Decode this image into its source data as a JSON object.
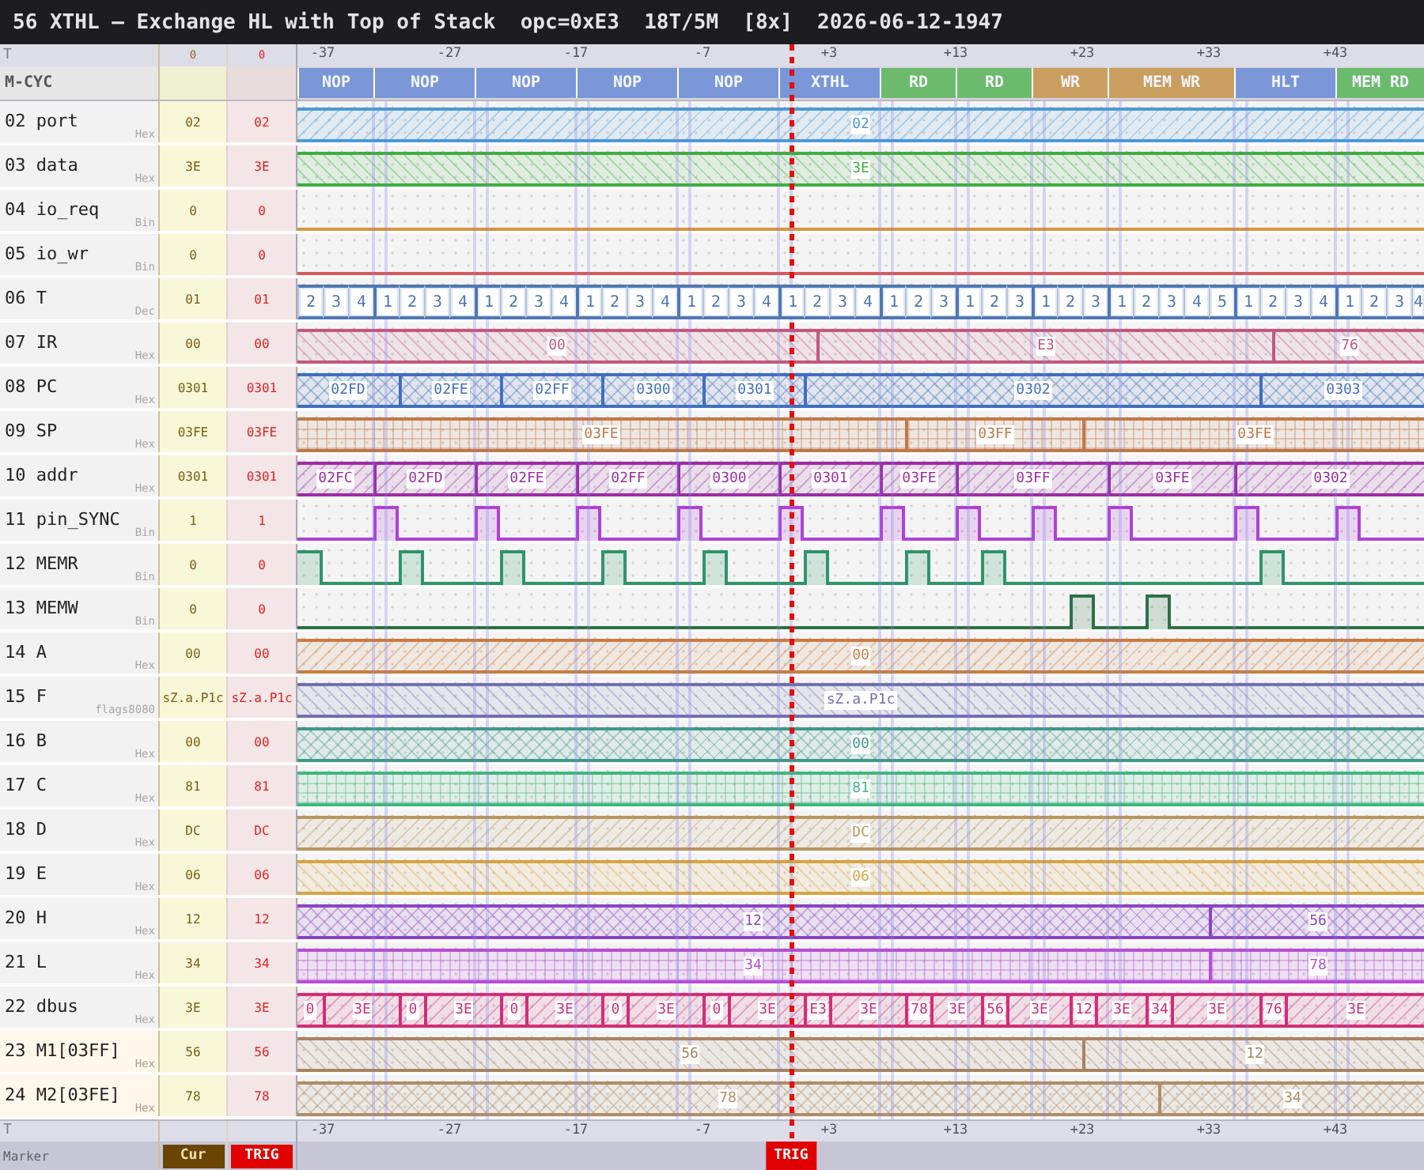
{
  "title": {
    "text": "56 XTHL — Exchange HL with Top of Stack",
    "info": [
      "opc=0xE3",
      "18T/5M",
      "[8x]",
      "2026-06-12-1947"
    ]
  },
  "timeline": {
    "label": "T",
    "cur": "0",
    "trig": "0",
    "ticks": [
      "-37",
      "-27",
      "-17",
      "-7",
      "+3",
      "+13",
      "+23",
      "+33",
      "+43"
    ]
  },
  "m_cycles": {
    "label": "M-CYC",
    "items": [
      {
        "label": "NOP",
        "color": "#7b97d8"
      },
      {
        "label": "NOP",
        "color": "#7b97d8"
      },
      {
        "label": "NOP",
        "color": "#7b97d8"
      },
      {
        "label": "NOP",
        "color": "#7b97d8"
      },
      {
        "label": "NOP",
        "color": "#7b97d8"
      },
      {
        "label": "XTHL",
        "color": "#7b97d8"
      },
      {
        "label": "RD",
        "color": "#6cba6c"
      },
      {
        "label": "RD",
        "color": "#6cba6c"
      },
      {
        "label": "WR",
        "color": "#c99e5e"
      },
      {
        "label": "MEM WR",
        "color": "#c99e5e"
      },
      {
        "label": "HLT",
        "color": "#7b97d8"
      },
      {
        "label": "MEM RD",
        "color": "#6cba6c"
      }
    ]
  },
  "rows": [
    {
      "name": "02 port",
      "format": "Hex",
      "cur": "02",
      "trig": "02",
      "watch": false,
      "kind": "bus",
      "color": "#4a9ad8",
      "segments": [
        {
          "value": "02"
        }
      ]
    },
    {
      "name": "03 data",
      "format": "Hex",
      "cur": "3E",
      "trig": "3E",
      "watch": false,
      "kind": "bus",
      "color": "#3fae3f",
      "segments": [
        {
          "value": "3E"
        }
      ]
    },
    {
      "name": "04 io_req",
      "format": "Bin",
      "cur": "0",
      "trig": "0",
      "watch": false,
      "kind": "bit",
      "color": "#d8963a",
      "segments": [
        {
          "high": false
        }
      ]
    },
    {
      "name": "05 io_wr",
      "format": "Bin",
      "cur": "0",
      "trig": "0",
      "watch": false,
      "kind": "bit",
      "color": "#d85a5a",
      "segments": [
        {
          "high": false
        }
      ]
    },
    {
      "name": "06 T",
      "format": "Dec",
      "cur": "01",
      "trig": "01",
      "watch": false,
      "kind": "tstate",
      "color": "#4f77b3",
      "cells": [
        "2",
        "3",
        "4",
        "1",
        "2",
        "3",
        "4",
        "1",
        "2",
        "3",
        "4",
        "1",
        "2",
        "3",
        "4",
        "1",
        "2",
        "3",
        "4",
        "1",
        "2",
        "3",
        "4",
        "1",
        "2",
        "3",
        "1",
        "2",
        "3",
        "1",
        "2",
        "3",
        "1",
        "2",
        "3",
        "4",
        "5",
        "1",
        "2",
        "3",
        "4",
        "1",
        "2",
        "3",
        "4"
      ]
    },
    {
      "name": "07 IR",
      "format": "Hex",
      "cur": "00",
      "trig": "00",
      "watch": false,
      "kind": "bus",
      "color": "#c2577f",
      "segments": [
        {
          "value": "00"
        },
        {
          "value": "E3"
        },
        {
          "value": "76"
        }
      ]
    },
    {
      "name": "08 PC",
      "format": "Hex",
      "cur": "0301",
      "trig": "0301",
      "watch": false,
      "kind": "bus",
      "color": "#3f6fbf",
      "segments": [
        {
          "value": "02FD"
        },
        {
          "value": "02FE"
        },
        {
          "value": "02FF"
        },
        {
          "value": "0300"
        },
        {
          "value": "0301"
        },
        {
          "value": "0302"
        },
        {
          "value": "0303"
        }
      ]
    },
    {
      "name": "09 SP",
      "format": "Hex",
      "cur": "03FE",
      "trig": "03FE",
      "watch": false,
      "kind": "bus",
      "color": "#c07848",
      "segments": [
        {
          "value": "03FE"
        },
        {
          "value": "03FF"
        },
        {
          "value": "03FE"
        }
      ]
    },
    {
      "name": "10 addr",
      "format": "Hex",
      "cur": "0301",
      "trig": "0301",
      "watch": false,
      "kind": "bus",
      "color": "#9c2ca4",
      "segments": [
        {
          "value": "02FC"
        },
        {
          "value": "02FD"
        },
        {
          "value": "02FE"
        },
        {
          "value": "02FF"
        },
        {
          "value": "0300"
        },
        {
          "value": "0301"
        },
        {
          "value": "03FE"
        },
        {
          "value": "03FF"
        },
        {
          "value": "03FE"
        },
        {
          "value": "0302"
        }
      ]
    },
    {
      "name": "11 pin_SYNC",
      "format": "Bin",
      "cur": "1",
      "trig": "1",
      "watch": false,
      "kind": "bit",
      "color": "#b040d8",
      "segments": [
        {
          "high": false
        },
        {
          "high": true
        },
        {
          "high": false
        },
        {
          "high": true
        },
        {
          "high": false
        },
        {
          "high": true
        },
        {
          "high": false
        },
        {
          "high": true
        },
        {
          "high": false
        },
        {
          "high": true
        },
        {
          "high": false
        },
        {
          "high": true
        },
        {
          "high": false
        },
        {
          "high": true
        },
        {
          "high": false
        },
        {
          "high": true
        },
        {
          "high": false
        },
        {
          "high": true
        },
        {
          "high": false
        },
        {
          "high": true
        },
        {
          "high": false
        },
        {
          "high": true
        },
        {
          "high": false
        }
      ]
    },
    {
      "name": "12 MEMR",
      "format": "Bin",
      "cur": "0",
      "trig": "0",
      "watch": false,
      "kind": "bit",
      "color": "#2f946a",
      "segments": [
        {
          "high": true
        },
        {
          "high": false
        },
        {
          "high": true
        },
        {
          "high": false
        },
        {
          "high": true
        },
        {
          "high": false
        },
        {
          "high": true
        },
        {
          "high": false
        },
        {
          "high": true
        },
        {
          "high": false
        },
        {
          "high": true
        },
        {
          "high": false
        },
        {
          "high": true
        },
        {
          "high": false
        },
        {
          "high": true
        },
        {
          "high": false
        },
        {
          "high": true
        },
        {
          "high": false
        }
      ]
    },
    {
      "name": "13 MEMW",
      "format": "Bin",
      "cur": "0",
      "trig": "0",
      "watch": false,
      "kind": "bit",
      "color": "#2e7048",
      "segments": [
        {
          "high": false
        },
        {
          "high": true
        },
        {
          "high": false
        },
        {
          "high": true
        },
        {
          "high": false
        }
      ]
    },
    {
      "name": "14 A",
      "format": "Hex",
      "cur": "00",
      "trig": "00",
      "watch": false,
      "kind": "bus",
      "color": "#c87c44",
      "segments": [
        {
          "value": "00"
        }
      ]
    },
    {
      "name": "15 F",
      "format": "flags8080",
      "cur": "sZ.a.P1c",
      "trig": "sZ.a.P1c",
      "watch": false,
      "kind": "bus",
      "color": "#7070b0",
      "segments": [
        {
          "value": "sZ.a.P1c"
        }
      ]
    },
    {
      "name": "16 B",
      "format": "Hex",
      "cur": "00",
      "trig": "00",
      "watch": false,
      "kind": "bus",
      "color": "#3f9a88",
      "segments": [
        {
          "value": "00"
        }
      ]
    },
    {
      "name": "17 C",
      "format": "Hex",
      "cur": "81",
      "trig": "81",
      "watch": false,
      "kind": "bus",
      "color": "#3fb880",
      "segments": [
        {
          "value": "81"
        }
      ]
    },
    {
      "name": "18 D",
      "format": "Hex",
      "cur": "DC",
      "trig": "DC",
      "watch": false,
      "kind": "bus",
      "color": "#b8965e",
      "segments": [
        {
          "value": "DC"
        }
      ]
    },
    {
      "name": "19 E",
      "format": "Hex",
      "cur": "06",
      "trig": "06",
      "watch": false,
      "kind": "bus",
      "color": "#d8a440",
      "segments": [
        {
          "value": "06"
        }
      ]
    },
    {
      "name": "20 H",
      "format": "Hex",
      "cur": "12",
      "trig": "12",
      "watch": false,
      "kind": "bus",
      "color": "#8a44c4",
      "segments": [
        {
          "value": "12"
        },
        {
          "value": "56"
        }
      ]
    },
    {
      "name": "21 L",
      "format": "Hex",
      "cur": "34",
      "trig": "34",
      "watch": false,
      "kind": "bus",
      "color": "#b84cd8",
      "segments": [
        {
          "value": "34"
        },
        {
          "value": "78"
        }
      ]
    },
    {
      "name": "22 dbus",
      "format": "Hex",
      "cur": "3E",
      "trig": "3E",
      "watch": false,
      "kind": "bus",
      "color": "#d42c78",
      "segments": [
        {
          "value": "0"
        },
        {
          "value": "3E"
        },
        {
          "value": "0"
        },
        {
          "value": "3E"
        },
        {
          "value": "0"
        },
        {
          "value": "3E"
        },
        {
          "value": "0"
        },
        {
          "value": "3E"
        },
        {
          "value": "0"
        },
        {
          "value": "3E"
        },
        {
          "value": "E3"
        },
        {
          "value": "3E"
        },
        {
          "value": "78"
        },
        {
          "value": "3E"
        },
        {
          "value": "56"
        },
        {
          "value": "3E"
        },
        {
          "value": "12"
        },
        {
          "value": "3E"
        },
        {
          "value": "34"
        },
        {
          "value": "3E"
        },
        {
          "value": "76"
        },
        {
          "value": "3E"
        }
      ]
    },
    {
      "name": "23 M1[03FF]",
      "format": "Hex",
      "cur": "56",
      "trig": "56",
      "watch": true,
      "kind": "bus",
      "color": "#a88460",
      "segments": [
        {
          "value": "56"
        },
        {
          "value": "12"
        }
      ]
    },
    {
      "name": "24 M2[03FE]",
      "format": "Hex",
      "cur": "78",
      "trig": "78",
      "watch": true,
      "kind": "bus",
      "color": "#b08c68",
      "segments": [
        {
          "value": "78"
        },
        {
          "value": "34"
        }
      ]
    }
  ],
  "footer": {
    "label": "T",
    "ticks": [
      "-37",
      "-27",
      "-17",
      "-7",
      "+3",
      "+13",
      "+23",
      "+33",
      "+43"
    ]
  },
  "markers": {
    "label": "Marker",
    "cur": "Cur",
    "trig": "TRIG",
    "trigger_flag": "TRIG"
  }
}
